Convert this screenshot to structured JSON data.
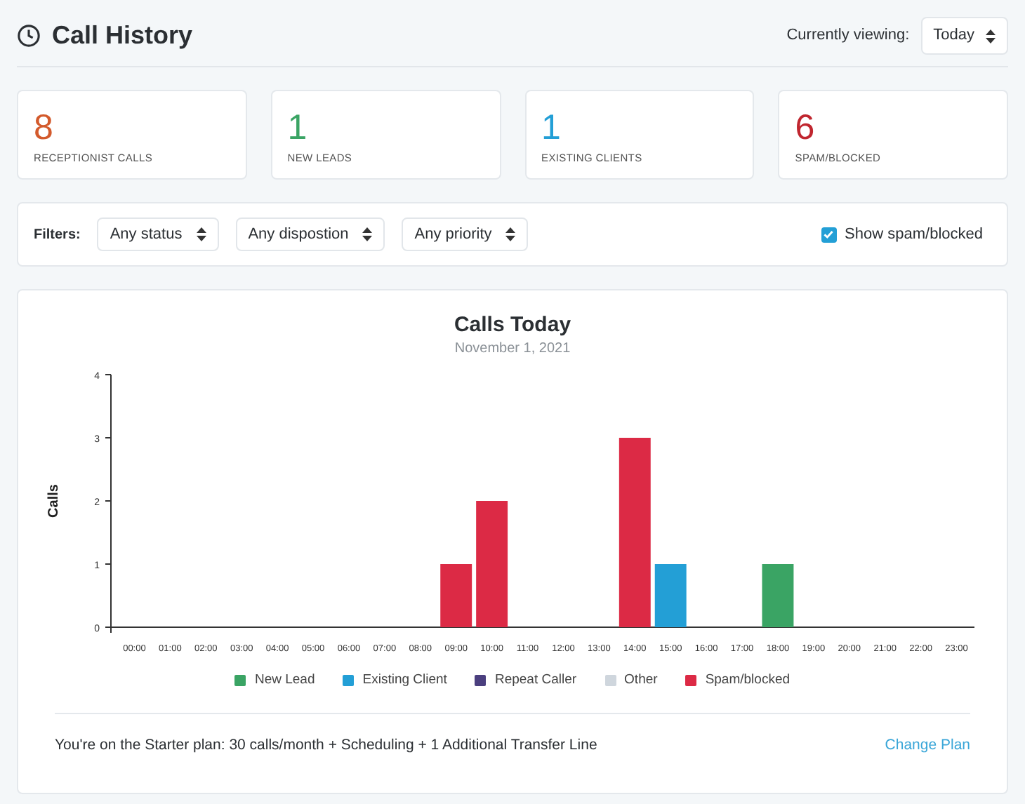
{
  "header": {
    "title": "Call History",
    "viewing_label": "Currently viewing:",
    "viewing_value": "Today"
  },
  "stats": [
    {
      "value": "8",
      "label": "RECEPTIONIST CALLS",
      "color": "#d35a2c"
    },
    {
      "value": "1",
      "label": "NEW LEADS",
      "color": "#3aa464"
    },
    {
      "value": "1",
      "label": "EXISTING CLIENTS",
      "color": "#239fd6"
    },
    {
      "value": "6",
      "label": "SPAM/BLOCKED",
      "color": "#c0262f"
    }
  ],
  "filters": {
    "label": "Filters:",
    "selects": [
      "Any status",
      "Any dispostion",
      "Any priority"
    ],
    "show_spam": {
      "label": "Show spam/blocked",
      "checked": true
    }
  },
  "chart": {
    "chart_data": {
      "type": "bar",
      "title": "Calls Today",
      "subtitle": "November 1, 2021",
      "ylabel": "Calls",
      "stacked": true,
      "categories": [
        "00:00",
        "01:00",
        "02:00",
        "03:00",
        "04:00",
        "05:00",
        "06:00",
        "07:00",
        "08:00",
        "09:00",
        "10:00",
        "11:00",
        "12:00",
        "13:00",
        "14:00",
        "15:00",
        "16:00",
        "17:00",
        "18:00",
        "19:00",
        "20:00",
        "21:00",
        "22:00",
        "23:00"
      ],
      "series": [
        {
          "name": "New Lead",
          "color": "#3aa464",
          "values": [
            0,
            0,
            0,
            0,
            0,
            0,
            0,
            0,
            0,
            0,
            0,
            0,
            0,
            0,
            0,
            0,
            0,
            0,
            1,
            0,
            0,
            0,
            0,
            0
          ]
        },
        {
          "name": "Existing Client",
          "color": "#239fd6",
          "values": [
            0,
            0,
            0,
            0,
            0,
            0,
            0,
            0,
            0,
            0,
            0,
            0,
            0,
            0,
            0,
            1,
            0,
            0,
            0,
            0,
            0,
            0,
            0,
            0
          ]
        },
        {
          "name": "Repeat Caller",
          "color": "#4b3f7f",
          "values": [
            0,
            0,
            0,
            0,
            0,
            0,
            0,
            0,
            0,
            0,
            0,
            0,
            0,
            0,
            0,
            0,
            0,
            0,
            0,
            0,
            0,
            0,
            0,
            0
          ]
        },
        {
          "name": "Other",
          "color": "#cfd6dd",
          "values": [
            0,
            0,
            0,
            0,
            0,
            0,
            0,
            0,
            0,
            0,
            0,
            0,
            0,
            0,
            0,
            0,
            0,
            0,
            0,
            0,
            0,
            0,
            0,
            0
          ]
        },
        {
          "name": "Spam/blocked",
          "color": "#dc2a45",
          "values": [
            0,
            0,
            0,
            0,
            0,
            0,
            0,
            0,
            0,
            1,
            2,
            0,
            0,
            0,
            3,
            0,
            0,
            0,
            0,
            0,
            0,
            0,
            0,
            0
          ]
        }
      ],
      "ylim": [
        0,
        4
      ],
      "yticks": [
        0,
        1,
        2,
        3,
        4
      ]
    }
  },
  "footer": {
    "plan_text": "You're on the Starter plan: 30 calls/month + Scheduling + 1 Additional Transfer Line",
    "link": "Change Plan"
  }
}
